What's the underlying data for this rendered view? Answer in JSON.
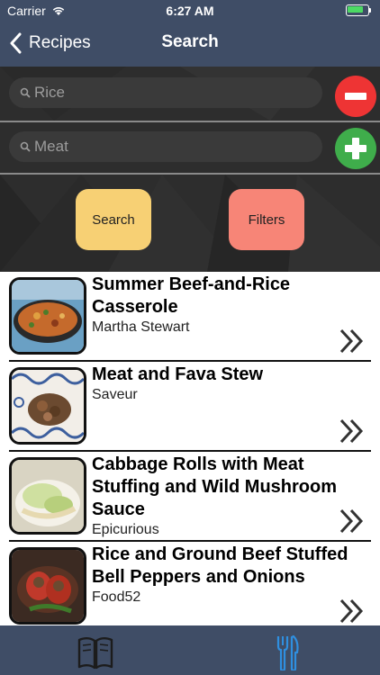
{
  "status_bar": {
    "carrier": "Carrier",
    "time": "6:27 AM",
    "battery_level": 0.85,
    "wifi_icon": "wifi-icon",
    "battery_icon": "battery-icon"
  },
  "nav": {
    "back_label": "Recipes",
    "title": "Search",
    "back_icon": "chevron-left-icon"
  },
  "search": {
    "include_field": {
      "placeholder": "Rice",
      "value": ""
    },
    "exclude_field": {
      "placeholder": "Meat",
      "value": ""
    },
    "remove_button_icon": "minus-circle-icon",
    "add_button_icon": "plus-circle-icon",
    "search_label": "Search",
    "filters_label": "Filters",
    "colors": {
      "remove": "#ee3434",
      "add": "#3fad4b",
      "search_btn": "#f7d074",
      "filters_btn": "#f78577"
    }
  },
  "results": [
    {
      "title": "Summer Beef-and-Rice Casserole",
      "source": "Martha Stewart",
      "image": "casserole-photo"
    },
    {
      "title": "Meat and Fava Stew",
      "source": "Saveur",
      "image": "stew-photo"
    },
    {
      "title": "Cabbage Rolls with Meat Stuffing and Wild Mushroom Sauce",
      "source": "Epicurious",
      "image": "cabbage-rolls-photo"
    },
    {
      "title": "Rice and Ground Beef Stuffed Bell Peppers and Onions",
      "source": "Food52",
      "image": "stuffed-peppers-photo"
    }
  ],
  "tabbar": {
    "tabs": [
      {
        "icon": "book-icon",
        "active": false
      },
      {
        "icon": "fork-knife-icon",
        "active": true
      }
    ],
    "active_color": "#2f8fe0"
  }
}
